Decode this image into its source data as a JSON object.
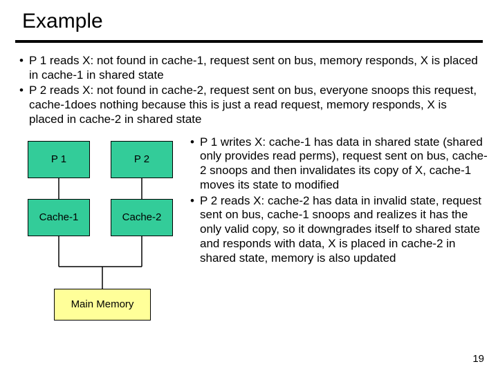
{
  "title": "Example",
  "top_bullets": [
    "P 1 reads X: not found in cache-1, request sent on bus, memory responds, X is placed in cache-1 in shared state",
    "P 2 reads X: not found in cache-2, request sent on bus, everyone snoops this request, cache-1does nothing because this is just a read request, memory responds, X is placed in cache-2 in shared state"
  ],
  "diagram": {
    "p1": "P 1",
    "p2": "P 2",
    "c1": "Cache-1",
    "c2": "Cache-2",
    "mem": "Main Memory"
  },
  "right_bullets": [
    "P 1 writes X: cache-1 has data in shared state (shared only provides read perms), request sent on bus, cache-2 snoops and then invalidates its copy of X, cache-1 moves its state to modified",
    "P 2 reads X: cache-2 has data in invalid state, request sent on bus, cache-1 snoops and realizes it has the only valid copy, so it downgrades itself to shared state and responds with data, X is placed in cache-2 in shared state, memory is also updated"
  ],
  "page_number": "19"
}
